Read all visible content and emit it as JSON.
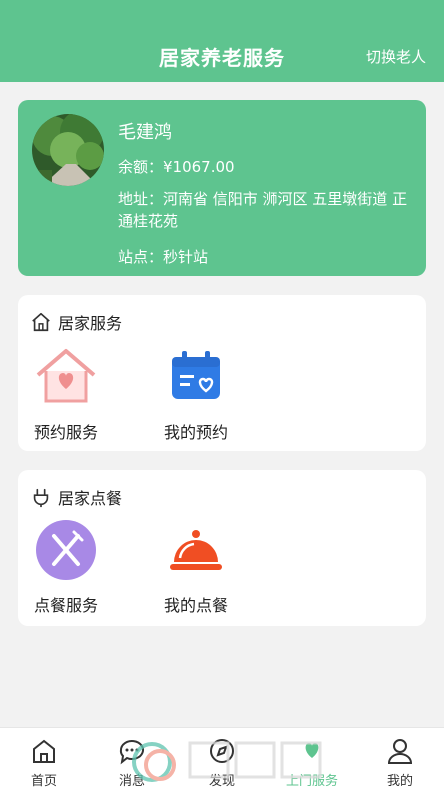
{
  "header": {
    "title": "居家养老服务",
    "switch_label": "切换老人"
  },
  "profile": {
    "name": "毛建鸿",
    "balance": "余额：¥1067.00",
    "address": "地址：河南省 信阳市 浉河区 五里墩街道 正通桂花苑",
    "station": "站点：秒针站"
  },
  "home_service": {
    "title": "居家服务",
    "items": [
      {
        "label": "预约服务",
        "icon": "house-heart-icon"
      },
      {
        "label": "我的预约",
        "icon": "calendar-heart-icon"
      }
    ]
  },
  "meal_service": {
    "title": "居家点餐",
    "items": [
      {
        "label": "点餐服务",
        "icon": "fork-knife-icon"
      },
      {
        "label": "我的点餐",
        "icon": "food-cloche-icon"
      }
    ]
  },
  "tabbar": {
    "items": [
      {
        "label": "首页",
        "icon": "home-icon"
      },
      {
        "label": "消息",
        "icon": "message-icon"
      },
      {
        "label": "发现",
        "icon": "discover-icon"
      },
      {
        "label": "上门服务",
        "icon": "door-service-icon"
      },
      {
        "label": "我的",
        "icon": "user-icon"
      }
    ],
    "active": "上门服务"
  },
  "colors": {
    "brand": "#5ec48f",
    "accent_orange": "#f04e23",
    "accent_purple": "#a889e6"
  }
}
